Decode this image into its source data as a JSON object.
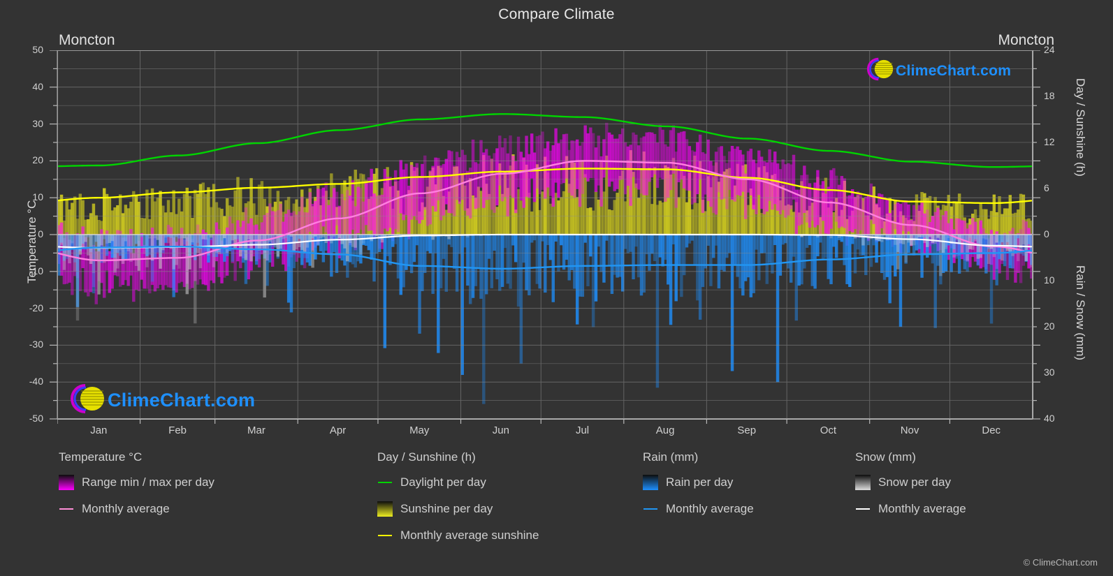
{
  "header": {
    "title": "Compare Climate",
    "city_left": "Moncton",
    "city_right": "Moncton"
  },
  "axes": {
    "left_title": "Temperature °C",
    "right_top_title": "Day / Sunshine (h)",
    "right_bottom_title": "Rain / Snow (mm)",
    "left_ticks": [
      "50",
      "40",
      "30",
      "20",
      "10",
      "0",
      "-10",
      "-20",
      "-30",
      "-40",
      "-50"
    ],
    "right_top_ticks": [
      "24",
      "18",
      "12",
      "6",
      "0"
    ],
    "right_bottom_ticks": [
      "0",
      "10",
      "20",
      "30",
      "40"
    ],
    "x_ticks": [
      "Jan",
      "Feb",
      "Mar",
      "Apr",
      "May",
      "Jun",
      "Jul",
      "Aug",
      "Sep",
      "Oct",
      "Nov",
      "Dec"
    ]
  },
  "legend": {
    "groups": [
      {
        "title": "Temperature °C",
        "items": [
          {
            "label": "Range min / max per day",
            "mark": "gradient-swatch",
            "color": "#ff00ff"
          },
          {
            "label": "Monthly average",
            "mark": "line",
            "color": "#ff8fd8"
          }
        ]
      },
      {
        "title": "Day / Sunshine (h)",
        "items": [
          {
            "label": "Daylight per day",
            "mark": "line",
            "color": "#00d400"
          },
          {
            "label": "Sunshine per day",
            "mark": "gradient-swatch",
            "color": "#eeee22"
          },
          {
            "label": "Monthly average sunshine",
            "mark": "line",
            "color": "#ffff00"
          }
        ]
      },
      {
        "title": "Rain (mm)",
        "items": [
          {
            "label": "Rain per day",
            "mark": "gradient-swatch",
            "color": "#1e90ff"
          },
          {
            "label": "Monthly average",
            "mark": "line",
            "color": "#2196f3"
          }
        ]
      },
      {
        "title": "Snow (mm)",
        "items": [
          {
            "label": "Snow per day",
            "mark": "gradient-swatch",
            "color": "#dddddd"
          },
          {
            "label": "Monthly average",
            "mark": "line",
            "color": "#ffffff"
          }
        ]
      }
    ]
  },
  "watermark": {
    "text": "ClimeChart.com",
    "copyright": "© ClimeChart.com"
  },
  "colors": {
    "background": "#333333",
    "grid": "#8d8d8d",
    "daylight": "#00d400",
    "sunshine_avg": "#ffff00",
    "sunshine_fill": "#d6d11f",
    "temp_avg": "#ff7fe0",
    "temp_fill": "#ff00ff",
    "rain": "#1e90ff",
    "rain_avg": "#2196f3",
    "snow": "#cfcfcf",
    "snow_avg": "#ffffff",
    "text": "#d8d8d8"
  },
  "chart_data": {
    "type": "line",
    "title": "Compare Climate",
    "subtitle": "Moncton",
    "xlabel": "",
    "ylabel": "Temperature °C",
    "y2label_top": "Day / Sunshine (h)",
    "y2label_bottom": "Rain / Snow (mm)",
    "ylim": [
      -50,
      50
    ],
    "y2lim_top": [
      0,
      24
    ],
    "y2lim_bottom": [
      0,
      40
    ],
    "grid": true,
    "legend_position": "below",
    "categories": [
      "Jan",
      "Feb",
      "Mar",
      "Apr",
      "May",
      "Jun",
      "Jul",
      "Aug",
      "Sep",
      "Oct",
      "Nov",
      "Dec"
    ],
    "series": [
      {
        "name": "Daylight per day",
        "unit": "h",
        "axis": "right_top",
        "color": "#00d400",
        "values": [
          9.0,
          10.3,
          11.9,
          13.6,
          15.0,
          15.7,
          15.3,
          14.1,
          12.5,
          10.9,
          9.5,
          8.8
        ]
      },
      {
        "name": "Monthly average sunshine",
        "unit": "h",
        "axis": "right_top",
        "color": "#ffff00",
        "values": [
          4.8,
          5.5,
          6.1,
          6.6,
          7.5,
          8.2,
          8.6,
          8.5,
          7.4,
          5.8,
          4.3,
          4.1
        ]
      },
      {
        "name": "Temperature monthly average",
        "unit": "°C",
        "axis": "left",
        "color": "#ff7fe0",
        "values": [
          -7.0,
          -6.3,
          -1.6,
          4.4,
          11.2,
          16.5,
          20.0,
          19.5,
          15.0,
          8.7,
          2.6,
          -3.2
        ]
      },
      {
        "name": "Rain monthly average",
        "unit": "mm",
        "axis": "right_bottom",
        "color": "#2196f3",
        "values": [
          2.8,
          2.6,
          3.2,
          4.3,
          6.8,
          7.4,
          6.8,
          6.6,
          6.6,
          5.4,
          4.3,
          4.0
        ]
      },
      {
        "name": "Snow monthly average",
        "unit": "mm",
        "axis": "right_bottom",
        "color": "#ffffff",
        "values": [
          2.9,
          2.7,
          2.2,
          1.1,
          0.2,
          0.0,
          0.0,
          0.0,
          0.0,
          0.1,
          1.0,
          2.4
        ]
      },
      {
        "name": "Temperature range max per day",
        "unit": "°C",
        "axis": "left",
        "color": "#ff00ff",
        "values": [
          -1.5,
          -0.8,
          3.6,
          10.0,
          17.5,
          22.5,
          25.5,
          25.0,
          20.5,
          13.5,
          6.5,
          0.8
        ]
      },
      {
        "name": "Temperature range min per day",
        "unit": "°C",
        "axis": "left",
        "color": "#ff00ff",
        "values": [
          -13.0,
          -12.5,
          -7.0,
          -1.0,
          4.5,
          10.0,
          13.5,
          13.0,
          8.5,
          3.0,
          -1.5,
          -8.0
        ]
      },
      {
        "name": "Sunshine per day (daily bars)",
        "unit": "h",
        "axis": "right_top",
        "color": "#d6d11f",
        "values": [
          4.8,
          5.5,
          6.1,
          6.6,
          7.5,
          8.2,
          8.6,
          8.5,
          7.4,
          5.8,
          4.3,
          4.1
        ]
      },
      {
        "name": "Rain per day (daily bars)",
        "unit": "mm",
        "axis": "right_bottom",
        "color": "#1e90ff",
        "values": [
          2.8,
          2.6,
          3.2,
          4.3,
          6.8,
          7.4,
          6.8,
          6.6,
          6.6,
          5.4,
          4.3,
          4.0
        ]
      },
      {
        "name": "Snow per day (daily bars)",
        "unit": "mm",
        "axis": "right_bottom",
        "color": "#cfcfcf",
        "values": [
          2.9,
          2.7,
          2.2,
          1.1,
          0.2,
          0.0,
          0.0,
          0.0,
          0.0,
          0.1,
          1.0,
          2.4
        ]
      }
    ]
  }
}
